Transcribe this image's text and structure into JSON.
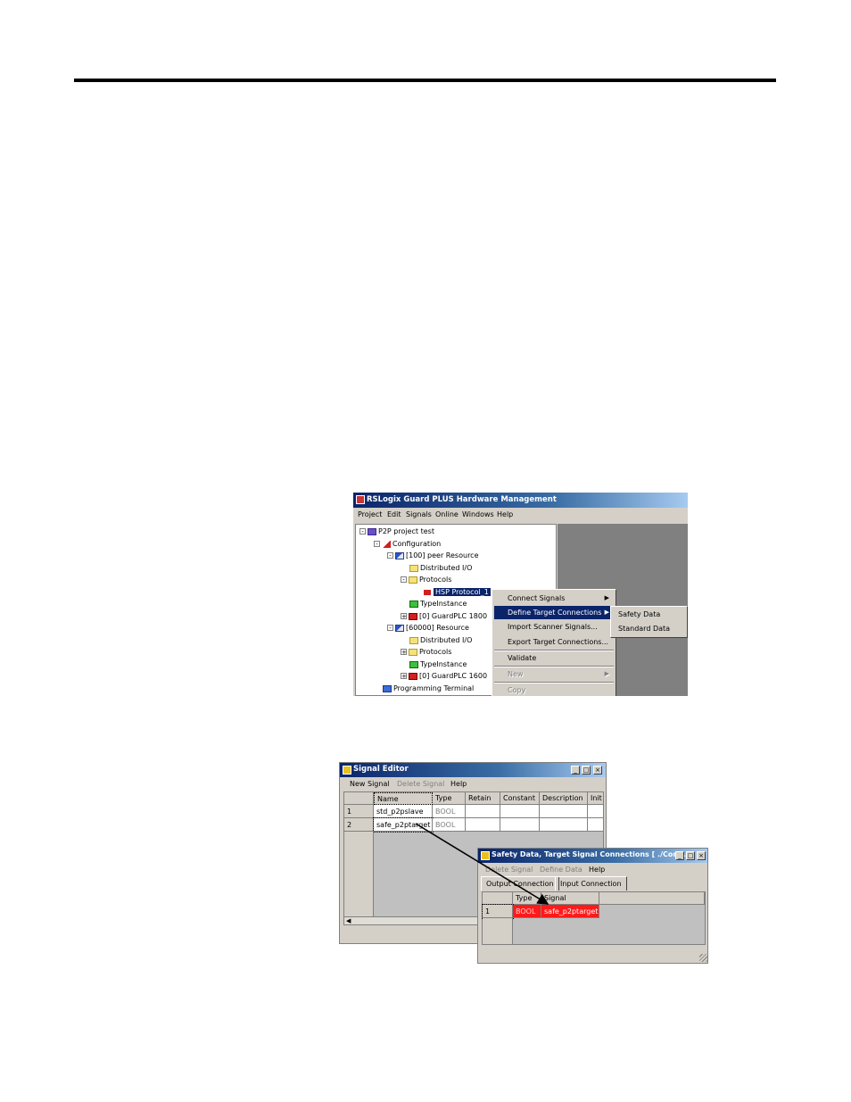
{
  "page": {
    "rule_color": "#000000"
  },
  "hardware_window": {
    "title": "RSLogix Guard PLUS Hardware Management",
    "menu": [
      "Project",
      "Edit",
      "Signals",
      "Online",
      "Windows",
      "Help"
    ],
    "tree": [
      {
        "label": "P2P project test",
        "icon": "project-icon"
      },
      {
        "label": "Configuration",
        "icon": "configuration-icon"
      },
      {
        "label": "[100] peer Resource",
        "icon": "resource-icon"
      },
      {
        "label": "Distributed I/O",
        "icon": "folder-icon"
      },
      {
        "label": "Protocols",
        "icon": "folder-icon"
      },
      {
        "label": "HSP Protocol_1",
        "icon": "protocol-icon"
      },
      {
        "label": "TypeInstance",
        "icon": "typeinstance-icon"
      },
      {
        "label": "[0] GuardPLC 1800",
        "icon": "plc-icon"
      },
      {
        "label": "[60000] Resource",
        "icon": "resource-icon"
      },
      {
        "label": "Distributed I/O",
        "icon": "folder-icon"
      },
      {
        "label": "Protocols",
        "icon": "folder-icon"
      },
      {
        "label": "TypeInstance",
        "icon": "typeinstance-icon"
      },
      {
        "label": "[0] GuardPLC 1600",
        "icon": "plc-icon"
      },
      {
        "label": "Programming Terminal",
        "icon": "terminal-icon"
      }
    ],
    "context_menu": {
      "connect_signals": "Connect Signals",
      "define_target": "Define Target Connections",
      "import_scanner": "Import Scanner Signals...",
      "export_target": "Export Target Connections...",
      "validate": "Validate",
      "new": "New",
      "copy": "Copy"
    },
    "submenu": {
      "safety_data": "Safety Data",
      "standard_data": "Standard Data"
    }
  },
  "signal_editor": {
    "title": "Signal Editor",
    "toolbar": {
      "new_signal": "New Signal",
      "delete_signal": "Delete Signal",
      "help": "Help"
    },
    "columns": [
      "Name",
      "Type",
      "Retain",
      "Constant",
      "Description",
      "Init V"
    ],
    "rows": [
      {
        "index": "1",
        "name": "std_p2pslave",
        "type": "BOOL"
      },
      {
        "index": "2",
        "name": "safe_p2ptarget",
        "type": "BOOL"
      }
    ]
  },
  "target_window": {
    "title": "Safety Data, Target Signal Connections [ ./Confi...",
    "toolbar": {
      "delete_signal": "Delete Signal",
      "define_data": "Define Data",
      "help": "Help"
    },
    "tabs": {
      "output": "Output Connection",
      "input": "Input Connection"
    },
    "columns": {
      "type": "Type",
      "signal": "Signal"
    },
    "row": {
      "index": "1",
      "type": "BOOL",
      "signal": "safe_p2ptarget"
    }
  }
}
